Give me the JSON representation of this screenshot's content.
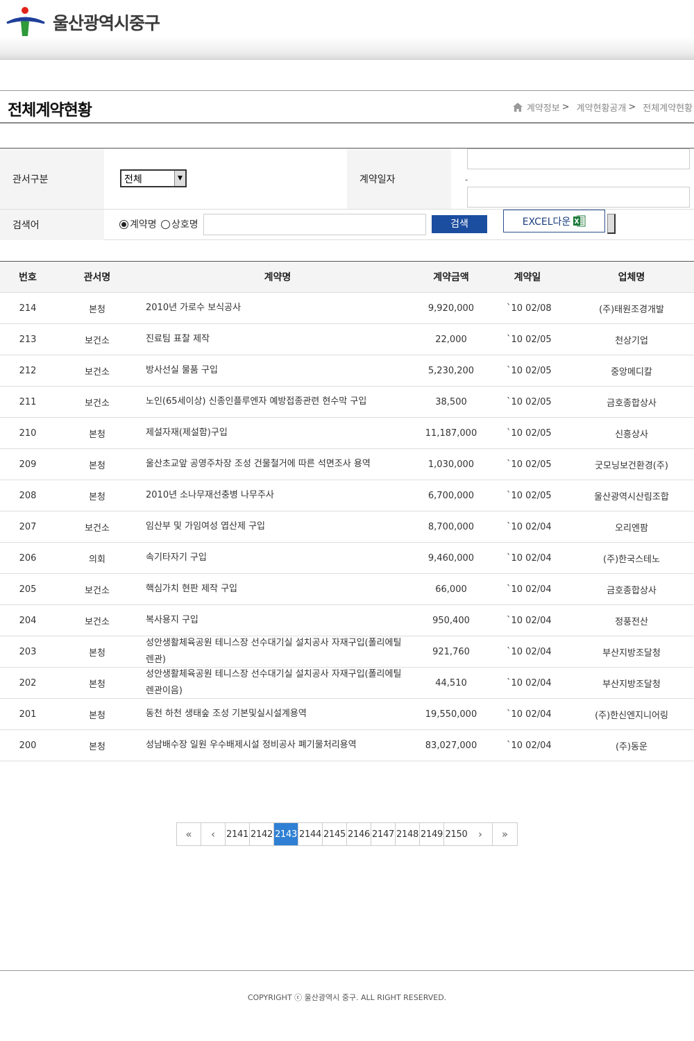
{
  "header": {
    "site_name": "울산광역시중구"
  },
  "page": {
    "title": "전체계약현황",
    "breadcrumb": [
      "계약정보",
      "계약현황공개",
      "전체계약현황"
    ]
  },
  "search": {
    "gwanseo_label": "관서구분",
    "gwanseo_value": "전체",
    "date_label": "계약일자",
    "date_separator": "-",
    "keyword_label": "검색어",
    "radio_contract": "계약명",
    "radio_company": "상호명",
    "search_button": "검색",
    "excel_button": "EXCEL다운"
  },
  "table": {
    "headers": [
      "번호",
      "관서명",
      "계약명",
      "계약금액",
      "계약일",
      "업체명"
    ],
    "rows": [
      {
        "no": "214",
        "office": "본청",
        "name": "2010년 가로수 보식공사",
        "amount": "9,920,000",
        "date": "`10 02/08",
        "company": "(주)태원조경개발"
      },
      {
        "no": "213",
        "office": "보건소",
        "name": "진료팀 표찰 제작",
        "amount": "22,000",
        "date": "`10 02/05",
        "company": "천상기업"
      },
      {
        "no": "212",
        "office": "보건소",
        "name": "방사선실 물품 구입",
        "amount": "5,230,200",
        "date": "`10 02/05",
        "company": "중앙메디칼"
      },
      {
        "no": "211",
        "office": "보건소",
        "name": "노인(65세이상) 신종인플루엔자 예방접종관련 현수막 구입",
        "amount": "38,500",
        "date": "`10 02/05",
        "company": "금호종합상사"
      },
      {
        "no": "210",
        "office": "본청",
        "name": "제설자재(제설함)구입",
        "amount": "11,187,000",
        "date": "`10 02/05",
        "company": "신흥상사"
      },
      {
        "no": "209",
        "office": "본청",
        "name": "울산초교앞 공영주차장 조성 건물철거에 따른 석면조사 용역",
        "amount": "1,030,000",
        "date": "`10 02/05",
        "company": "굿모닝보건환경(주)"
      },
      {
        "no": "208",
        "office": "본청",
        "name": "2010년 소나무재선충병 나무주사",
        "amount": "6,700,000",
        "date": "`10 02/05",
        "company": "울산광역시산림조합"
      },
      {
        "no": "207",
        "office": "보건소",
        "name": "임산부 및 가임여성 엽산제 구입",
        "amount": "8,700,000",
        "date": "`10 02/04",
        "company": "오리엔팜"
      },
      {
        "no": "206",
        "office": "의회",
        "name": "속기타자기 구입",
        "amount": "9,460,000",
        "date": "`10 02/04",
        "company": "(주)한국스테노"
      },
      {
        "no": "205",
        "office": "보건소",
        "name": "핵심가치 현판 제작 구입",
        "amount": "66,000",
        "date": "`10 02/04",
        "company": "금호종합상사"
      },
      {
        "no": "204",
        "office": "보건소",
        "name": "복사용지 구입",
        "amount": "950,400",
        "date": "`10 02/04",
        "company": "정풍전산"
      },
      {
        "no": "203",
        "office": "본청",
        "name": "성안생활체육공원 테니스장 선수대기실 설치공사 자재구입(폴리에틸렌관)",
        "amount": "921,760",
        "date": "`10 02/04",
        "company": "부산지방조달청"
      },
      {
        "no": "202",
        "office": "본청",
        "name": "성안생활체육공원 테니스장 선수대기실 설치공사 자재구입(폴리에틸렌관이음)",
        "amount": "44,510",
        "date": "`10 02/04",
        "company": "부산지방조달청"
      },
      {
        "no": "201",
        "office": "본청",
        "name": "동천 하천 생태숲 조성 기본및실시설계용역",
        "amount": "19,550,000",
        "date": "`10 02/04",
        "company": "(주)한신엔지니어링"
      },
      {
        "no": "200",
        "office": "본청",
        "name": "성남배수장 일원 우수배제시설 정비공사 폐기물처리용역",
        "amount": "83,027,000",
        "date": "`10 02/04",
        "company": "(주)동운"
      }
    ]
  },
  "pagination": {
    "first": "«",
    "prev": "‹",
    "pages": [
      "2141",
      "2142",
      "2143",
      "2144",
      "2145",
      "2146",
      "2147",
      "2148",
      "2149",
      "2150"
    ],
    "current": "2143",
    "next": "›",
    "last": "»"
  },
  "footer": {
    "copyright": "COPYRIGHT ⓒ 울산광역시 중구. ALL RIGHT RESERVED."
  },
  "colors": {
    "accent": "#2f80d4",
    "button_blue": "#1c4ea0",
    "logo_red": "#e2231a",
    "logo_green": "#2e9a3a",
    "logo_blue": "#1f3f9a"
  }
}
